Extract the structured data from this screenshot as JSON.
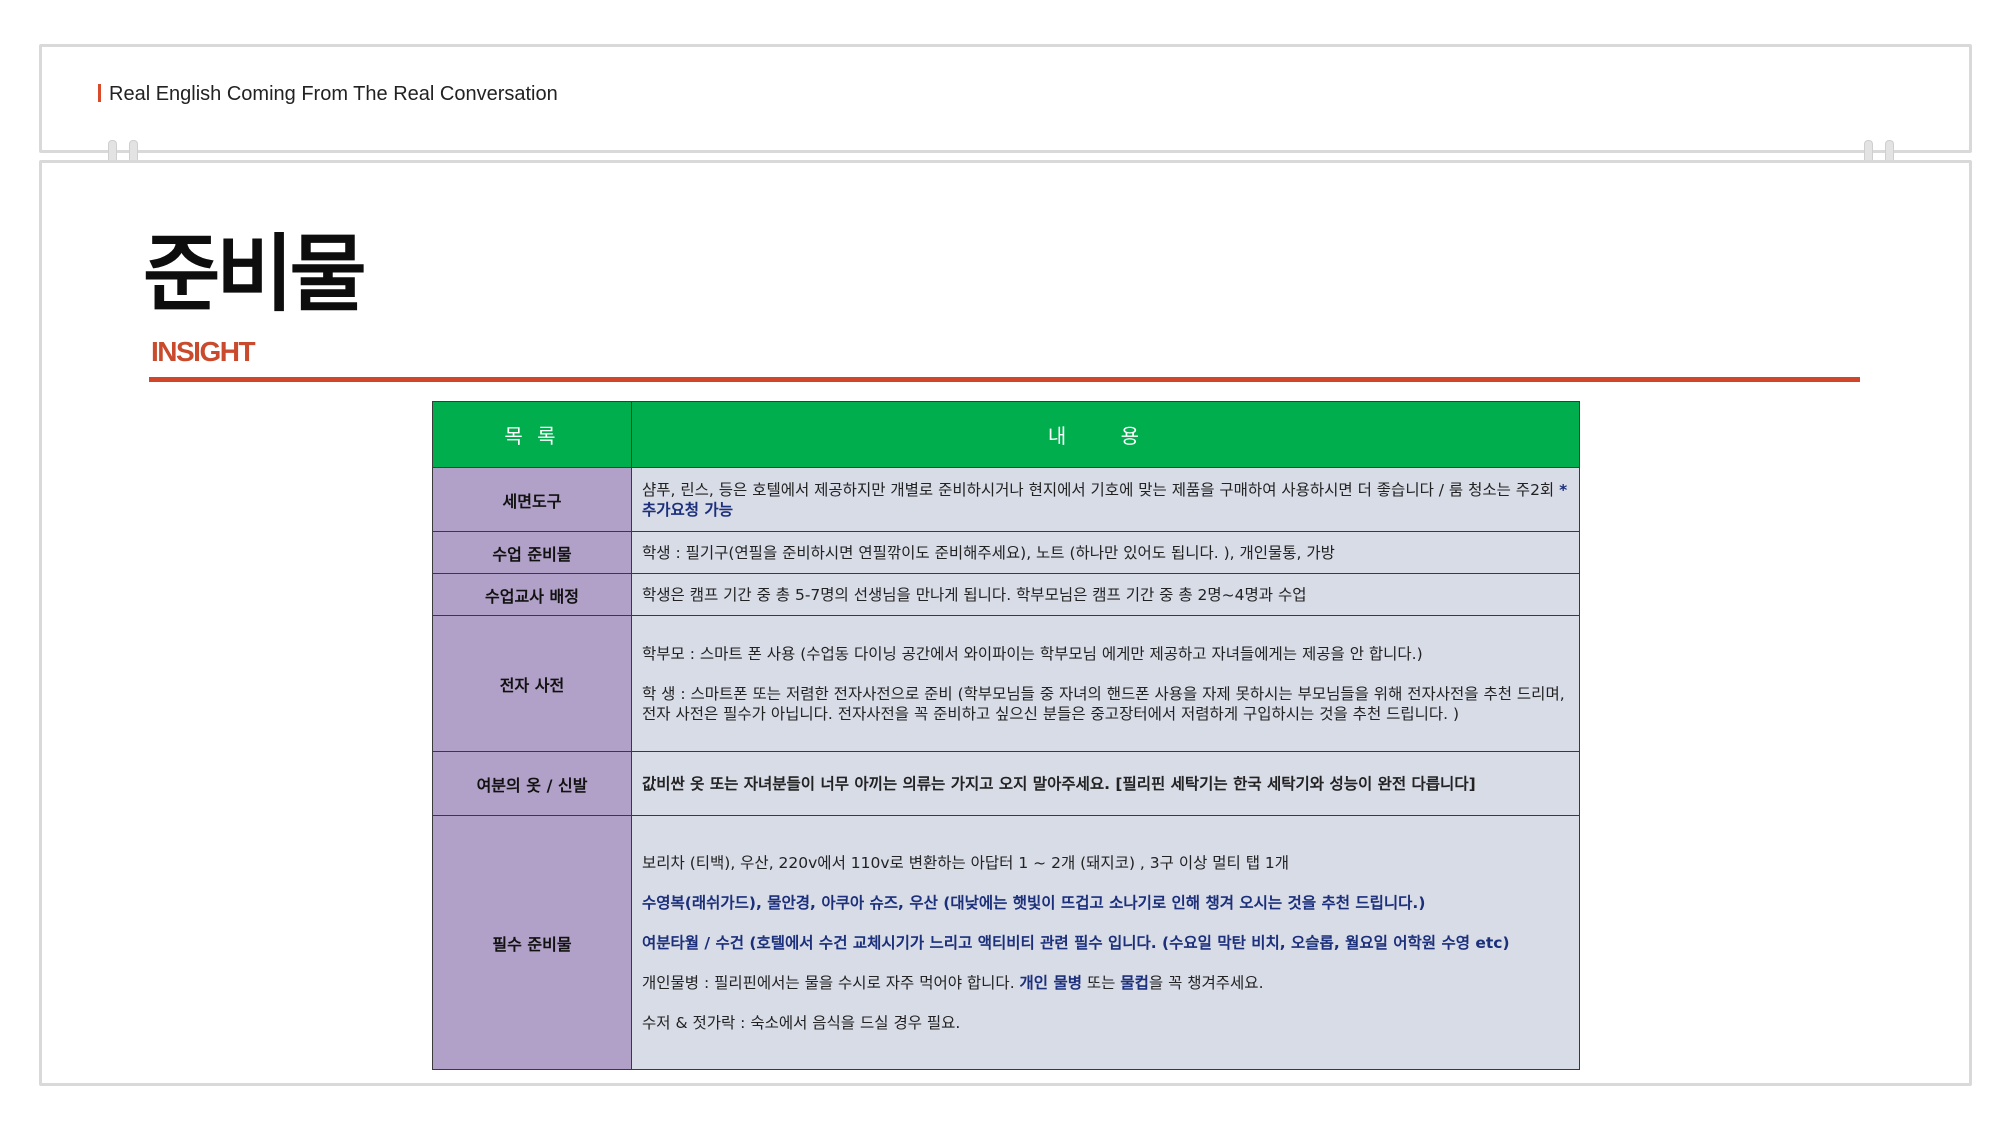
{
  "header": {
    "tagline": "Real English Coming From The Real Conversation"
  },
  "page": {
    "title": "준비물",
    "subtitle": "INSIGHT"
  },
  "colors": {
    "accent": "#d1462a",
    "table_header": "#00ae4d",
    "category_cell": "#b1a1c8",
    "content_cell": "#d8dce7",
    "highlight_text": "#1b2f7a"
  },
  "table": {
    "headers": [
      "목 록",
      "내 용"
    ],
    "rows": [
      {
        "category": "세면도구",
        "text1": "샴푸, 린스, 등은 호텔에서 제공하지만 개별로 준비하시거나 현지에서 기호에 맞는 제품을 구매하여 사용하시면 더 좋습니다 / 룸 청소는 주2회 ",
        "text1_hl": "*추가요청 가능"
      },
      {
        "category": "수업 준비물",
        "text": "학생 : 필기구(연필을 준비하시면 연필깎이도 준비해주세요), 노트 (하나만 있어도 됩니다. ), 개인물통, 가방"
      },
      {
        "category": "수업교사 배정",
        "text": "학생은 캠프 기간 중 총 5-7명의 선생님을 만나게 됩니다. 학부모님은 캠프 기간 중 총 2명~4명과 수업"
      },
      {
        "category": "전자 사전",
        "line1": "학부모 : 스마트 폰 사용 (수업동 다이닝 공간에서 와이파이는 학부모님 에게만 제공하고 자녀들에게는 제공을 안 합니다.)",
        "line2": "학 생 : 스마트폰 또는 저렴한 전자사전으로 준비 (학부모님들 중 자녀의 핸드폰 사용을 자제 못하시는 부모님들을 위해 전자사전을 추천 드리며, 전자 사전은 필수가 아닙니다. 전자사전을 꼭 준비하고 싶으신 분들은 중고장터에서 저렴하게 구입하시는 것을 추천 드립니다. )"
      },
      {
        "category": "여분의 옷 / 신발",
        "text_hl": "값비싼 옷 또는 자녀분들이 너무 아끼는 의류는 가지고 오지 말아주세요. [필리핀 세탁기는 한국 세탁기와 성능이 완전 다릅니다]"
      },
      {
        "category": "필수 준비물",
        "line1": "보리차 (티백), 우산, 220v에서 110v로 변환하는 아답터 1 ~ 2개 (돼지코) , 3구 이상 멀티 탭 1개",
        "line2_hl": "수영복(래쉬가드), 물안경, 아쿠아 슈즈, 우산 (대낮에는 햇빛이 뜨겁고 소나기로 인해 챙겨 오시는 것을 추천 드립니다.)",
        "line3_hl": "여분타월 / 수건 (호텔에서 수건 교체시기가 느리고 액티비티 관련 필수 입니다. (수요일 막탄 비치, 오슬롭, 월요일 어학원 수영 etc)",
        "line4_a": "개인물병 : 필리핀에서는 물을 수시로 자주 먹어야 합니다. ",
        "line4_hl1": "개인 물병",
        "line4_b": " 또는 ",
        "line4_hl2": "물컵",
        "line4_c": "을 꼭 챙겨주세요.",
        "line5": "수저 & 젓가락 : 숙소에서 음식을 드실 경우 필요."
      }
    ]
  }
}
